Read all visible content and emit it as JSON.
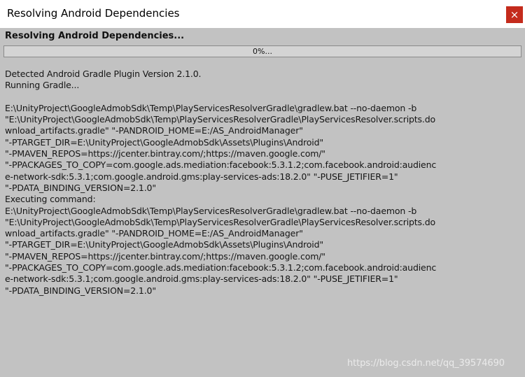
{
  "window": {
    "title": "Resolving Android Dependencies",
    "close_glyph": "×",
    "close_icon": "close-icon",
    "close_color": "#c42b1c"
  },
  "dialog": {
    "heading": "Resolving Android Dependencies...",
    "progress": {
      "value_percent": 0,
      "label": "0%..."
    },
    "log_lines": [
      "Detected Android Gradle Plugin Version 2.1.0.",
      "Running Gradle...",
      "",
      "E:\\UnityProject\\GoogleAdmobSdk\\Temp\\PlayServicesResolverGradle\\gradlew.bat --no-daemon -b",
      "\"E:\\UnityProject\\GoogleAdmobSdk\\Temp\\PlayServicesResolverGradle\\PlayServicesResolver.scripts.do",
      "wnload_artifacts.gradle\" \"-PANDROID_HOME=E:/AS_AndroidManager\"",
      "\"-PTARGET_DIR=E:\\UnityProject\\GoogleAdmobSdk\\Assets\\Plugins\\Android\"",
      "\"-PMAVEN_REPOS=https://jcenter.bintray.com/;https://maven.google.com/\"",
      "\"-PPACKAGES_TO_COPY=com.google.ads.mediation:facebook:5.3.1.2;com.facebook.android:audienc",
      "e-network-sdk:5.3.1;com.google.android.gms:play-services-ads:18.2.0\" \"-PUSE_JETIFIER=1\"",
      "\"-PDATA_BINDING_VERSION=2.1.0\"",
      "Executing command:",
      "E:\\UnityProject\\GoogleAdmobSdk\\Temp\\PlayServicesResolverGradle\\gradlew.bat --no-daemon -b",
      "\"E:\\UnityProject\\GoogleAdmobSdk\\Temp\\PlayServicesResolverGradle\\PlayServicesResolver.scripts.do",
      "wnload_artifacts.gradle\" \"-PANDROID_HOME=E:/AS_AndroidManager\"",
      "\"-PTARGET_DIR=E:\\UnityProject\\GoogleAdmobSdk\\Assets\\Plugins\\Android\"",
      "\"-PMAVEN_REPOS=https://jcenter.bintray.com/;https://maven.google.com/\"",
      "\"-PPACKAGES_TO_COPY=com.google.ads.mediation:facebook:5.3.1.2;com.facebook.android:audienc",
      "e-network-sdk:5.3.1;com.google.android.gms:play-services-ads:18.2.0\" \"-PUSE_JETIFIER=1\"",
      "\"-PDATA_BINDING_VERSION=2.1.0\""
    ]
  },
  "watermark": {
    "text": "https://blog.csdn.net/qq_39574690"
  }
}
